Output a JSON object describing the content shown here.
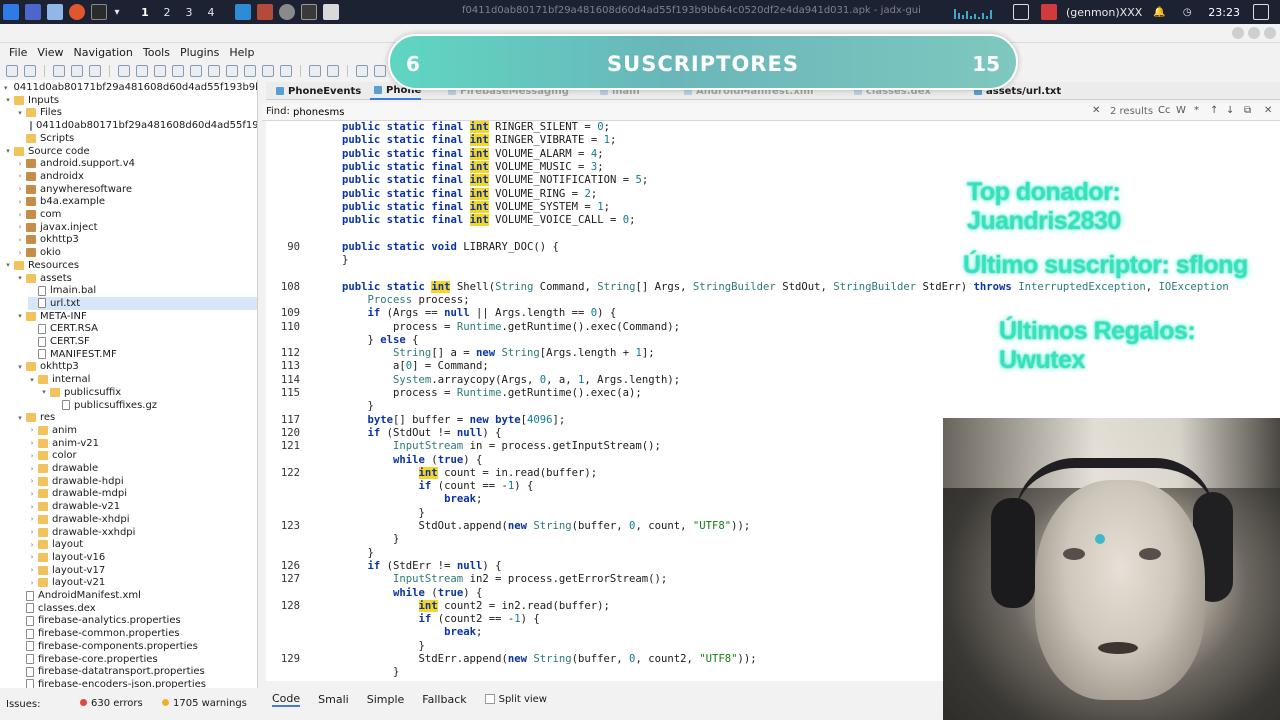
{
  "taskbar": {
    "workspaces": [
      "1",
      "2",
      "3",
      "4"
    ],
    "window_title": "f0411d0ab80171bf29a481608d60d4ad55f193b9bb64c0520df2e4da941d031.apk - jadx-gui",
    "user": "(genmon)XXX",
    "clock": "23:23"
  },
  "menu": [
    "File",
    "View",
    "Navigation",
    "Tools",
    "Plugins",
    "Help"
  ],
  "tree": [
    {
      "depth": 0,
      "tw": "▾",
      "icon": "root",
      "label": "0411d0ab80171bf29a481608d60d4ad55f193b9bb64"
    },
    {
      "depth": 0,
      "tw": "▾",
      "icon": "folder",
      "label": "Inputs"
    },
    {
      "depth": 1,
      "tw": "▾",
      "icon": "folder",
      "label": "Files"
    },
    {
      "depth": 2,
      "tw": "",
      "icon": "file",
      "label": "0411d0ab80171bf29a481608d60d4ad55f193b9"
    },
    {
      "depth": 1,
      "tw": "",
      "icon": "folder",
      "label": "Scripts"
    },
    {
      "depth": 0,
      "tw": "▾",
      "icon": "folder",
      "label": "Source code"
    },
    {
      "depth": 1,
      "tw": "›",
      "icon": "pkg",
      "label": "android.support.v4"
    },
    {
      "depth": 1,
      "tw": "›",
      "icon": "pkg",
      "label": "androidx"
    },
    {
      "depth": 1,
      "tw": "›",
      "icon": "pkg",
      "label": "anywheresoftware"
    },
    {
      "depth": 1,
      "tw": "›",
      "icon": "pkg",
      "label": "b4a.example"
    },
    {
      "depth": 1,
      "tw": "›",
      "icon": "pkg",
      "label": "com"
    },
    {
      "depth": 1,
      "tw": "›",
      "icon": "pkg",
      "label": "javax.inject"
    },
    {
      "depth": 1,
      "tw": "›",
      "icon": "pkg",
      "label": "okhttp3"
    },
    {
      "depth": 1,
      "tw": "›",
      "icon": "pkg",
      "label": "okio"
    },
    {
      "depth": 0,
      "tw": "▾",
      "icon": "folder",
      "label": "Resources"
    },
    {
      "depth": 1,
      "tw": "▾",
      "icon": "folder",
      "label": "assets"
    },
    {
      "depth": 2,
      "tw": "",
      "icon": "file",
      "label": "lmain.bal"
    },
    {
      "depth": 2,
      "tw": "",
      "icon": "file",
      "label": "url.txt",
      "selected": true
    },
    {
      "depth": 1,
      "tw": "▾",
      "icon": "folder",
      "label": "META-INF"
    },
    {
      "depth": 2,
      "tw": "",
      "icon": "file",
      "label": "CERT.RSA"
    },
    {
      "depth": 2,
      "tw": "",
      "icon": "file",
      "label": "CERT.SF"
    },
    {
      "depth": 2,
      "tw": "",
      "icon": "file",
      "label": "MANIFEST.MF"
    },
    {
      "depth": 1,
      "tw": "▾",
      "icon": "folder",
      "label": "okhttp3"
    },
    {
      "depth": 2,
      "tw": "▾",
      "icon": "folder",
      "label": "internal"
    },
    {
      "depth": 3,
      "tw": "▾",
      "icon": "folder",
      "label": "publicsuffix"
    },
    {
      "depth": 4,
      "tw": "",
      "icon": "file",
      "label": "publicsuffixes.gz"
    },
    {
      "depth": 1,
      "tw": "▾",
      "icon": "folder",
      "label": "res"
    },
    {
      "depth": 2,
      "tw": "›",
      "icon": "folder",
      "label": "anim"
    },
    {
      "depth": 2,
      "tw": "›",
      "icon": "folder",
      "label": "anim-v21"
    },
    {
      "depth": 2,
      "tw": "›",
      "icon": "folder",
      "label": "color"
    },
    {
      "depth": 2,
      "tw": "›",
      "icon": "folder",
      "label": "drawable"
    },
    {
      "depth": 2,
      "tw": "›",
      "icon": "folder",
      "label": "drawable-hdpi"
    },
    {
      "depth": 2,
      "tw": "›",
      "icon": "folder",
      "label": "drawable-mdpi"
    },
    {
      "depth": 2,
      "tw": "›",
      "icon": "folder",
      "label": "drawable-v21"
    },
    {
      "depth": 2,
      "tw": "›",
      "icon": "folder",
      "label": "drawable-xhdpi"
    },
    {
      "depth": 2,
      "tw": "›",
      "icon": "folder",
      "label": "drawable-xxhdpi"
    },
    {
      "depth": 2,
      "tw": "›",
      "icon": "folder",
      "label": "layout"
    },
    {
      "depth": 2,
      "tw": "›",
      "icon": "folder",
      "label": "layout-v16"
    },
    {
      "depth": 2,
      "tw": "›",
      "icon": "folder",
      "label": "layout-v17"
    },
    {
      "depth": 2,
      "tw": "›",
      "icon": "folder",
      "label": "layout-v21"
    },
    {
      "depth": 1,
      "tw": "",
      "icon": "file",
      "label": "AndroidManifest.xml"
    },
    {
      "depth": 1,
      "tw": "",
      "icon": "file",
      "label": "classes.dex"
    },
    {
      "depth": 1,
      "tw": "",
      "icon": "file",
      "label": "firebase-analytics.properties"
    },
    {
      "depth": 1,
      "tw": "",
      "icon": "file",
      "label": "firebase-common.properties"
    },
    {
      "depth": 1,
      "tw": "",
      "icon": "file",
      "label": "firebase-components.properties"
    },
    {
      "depth": 1,
      "tw": "",
      "icon": "file",
      "label": "firebase-core.properties"
    },
    {
      "depth": 1,
      "tw": "",
      "icon": "file",
      "label": "firebase-datatransport.properties"
    },
    {
      "depth": 1,
      "tw": "",
      "icon": "file",
      "label": "firebase-encoders-json.properties"
    }
  ],
  "tabs": [
    {
      "label": "PhoneEvents"
    },
    {
      "label": "Phone",
      "active": true
    },
    {
      "label": "FirebaseMessaging"
    },
    {
      "label": "main"
    },
    {
      "label": "AndroidManifest.xml"
    },
    {
      "label": "classes.dex"
    },
    {
      "label": "assets/url.txt"
    }
  ],
  "find": {
    "label": "Find:",
    "value": "phonesms",
    "results": "2 results",
    "options": [
      "Cc",
      "W",
      "*",
      "↑",
      "↓"
    ]
  },
  "code": [
    {
      "ln": "",
      "t": "public static final int RINGER_SILENT = 0;"
    },
    {
      "ln": "",
      "t": "public static final int RINGER_VIBRATE = 1;"
    },
    {
      "ln": "",
      "t": "public static final int VOLUME_ALARM = 4;"
    },
    {
      "ln": "",
      "t": "public static final int VOLUME_MUSIC = 3;"
    },
    {
      "ln": "",
      "t": "public static final int VOLUME_NOTIFICATION = 5;"
    },
    {
      "ln": "",
      "t": "public static final int VOLUME_RING = 2;"
    },
    {
      "ln": "",
      "t": "public static final int VOLUME_SYSTEM = 1;"
    },
    {
      "ln": "",
      "t": "public static final int VOLUME_VOICE_CALL = 0;"
    },
    {
      "ln": "",
      "t": ""
    },
    {
      "ln": "90",
      "t": "public static void LIBRARY_DOC() {"
    },
    {
      "ln": "",
      "t": "}"
    },
    {
      "ln": "",
      "t": ""
    },
    {
      "ln": "108",
      "t": "public static int Shell(String Command, String[] Args, StringBuilder StdOut, StringBuilder StdErr) throws InterruptedException, IOException"
    },
    {
      "ln": "",
      "t": "    Process process;"
    },
    {
      "ln": "109",
      "t": "    if (Args == null || Args.length == 0) {"
    },
    {
      "ln": "110",
      "t": "        process = Runtime.getRuntime().exec(Command);"
    },
    {
      "ln": "",
      "t": "    } else {"
    },
    {
      "ln": "112",
      "t": "        String[] a = new String[Args.length + 1];"
    },
    {
      "ln": "113",
      "t": "        a[0] = Command;"
    },
    {
      "ln": "114",
      "t": "        System.arraycopy(Args, 0, a, 1, Args.length);"
    },
    {
      "ln": "115",
      "t": "        process = Runtime.getRuntime().exec(a);"
    },
    {
      "ln": "",
      "t": "    }"
    },
    {
      "ln": "117",
      "t": "    byte[] buffer = new byte[4096];"
    },
    {
      "ln": "120",
      "t": "    if (StdOut != null) {"
    },
    {
      "ln": "121",
      "t": "        InputStream in = process.getInputStream();"
    },
    {
      "ln": "",
      "t": "        while (true) {"
    },
    {
      "ln": "122",
      "t": "            int count = in.read(buffer);"
    },
    {
      "ln": "",
      "t": "            if (count == -1) {"
    },
    {
      "ln": "",
      "t": "                break;"
    },
    {
      "ln": "",
      "t": "            }"
    },
    {
      "ln": "123",
      "t": "            StdOut.append(new String(buffer, 0, count, \"UTF8\"));"
    },
    {
      "ln": "",
      "t": "        }"
    },
    {
      "ln": "",
      "t": "    }"
    },
    {
      "ln": "126",
      "t": "    if (StdErr != null) {"
    },
    {
      "ln": "127",
      "t": "        InputStream in2 = process.getErrorStream();"
    },
    {
      "ln": "",
      "t": "        while (true) {"
    },
    {
      "ln": "128",
      "t": "            int count2 = in2.read(buffer);"
    },
    {
      "ln": "",
      "t": "            if (count2 == -1) {"
    },
    {
      "ln": "",
      "t": "                break;"
    },
    {
      "ln": "",
      "t": "            }"
    },
    {
      "ln": "129",
      "t": "            StdErr.append(new String(buffer, 0, count2, \"UTF8\"));"
    },
    {
      "ln": "",
      "t": "        }"
    }
  ],
  "bottom_tabs": [
    "Code",
    "Smali",
    "Simple",
    "Fallback"
  ],
  "split_view": "Split view",
  "status": {
    "issues_label": "Issues:",
    "errors": "630 errors",
    "warnings": "1705 warnings"
  },
  "overlay": {
    "sub_left": "6",
    "sub_title": "SUSCRIPTORES",
    "sub_right": "15",
    "top_donor": "Top donador: Juandris2830",
    "last_sub": "Último suscriptor: sflong",
    "last_gifts": "Últimos Regalos: Uwutex"
  },
  "colors": {
    "keyword": "#0a33a6",
    "type": "#2e7a7a",
    "number": "#0c7b93",
    "string": "#157a15",
    "highlight": "#f5d623",
    "overlay_glow": "#39e0bd",
    "banner": "#6ab6b9"
  }
}
